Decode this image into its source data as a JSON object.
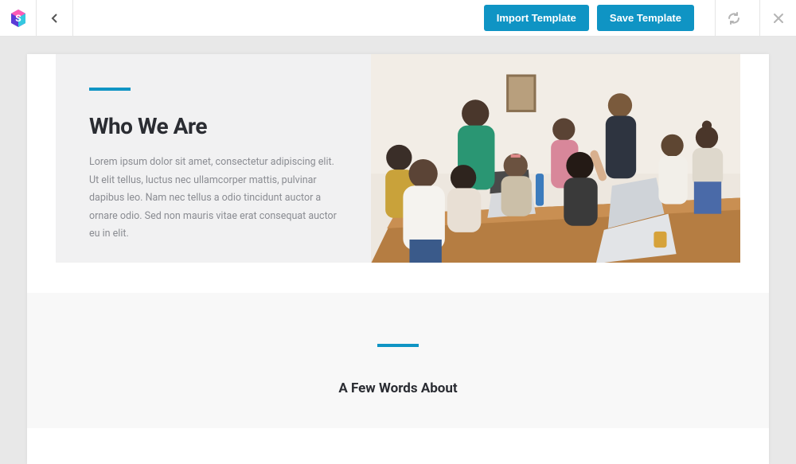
{
  "toolbar": {
    "import_label": "Import Template",
    "save_label": "Save Template"
  },
  "hero": {
    "title": "Who We Are",
    "body": "Lorem ipsum dolor sit amet, consectetur adipiscing elit. Ut elit tellus, luctus nec ullamcorper mattis, pulvinar dapibus leo. Nam nec tellus a odio tincidunt auctor a ornare odio. Sed non mauris vitae erat consequat auctor eu in elit."
  },
  "section2": {
    "title": "A Few Words About"
  },
  "colors": {
    "accent": "#0f94c4"
  }
}
